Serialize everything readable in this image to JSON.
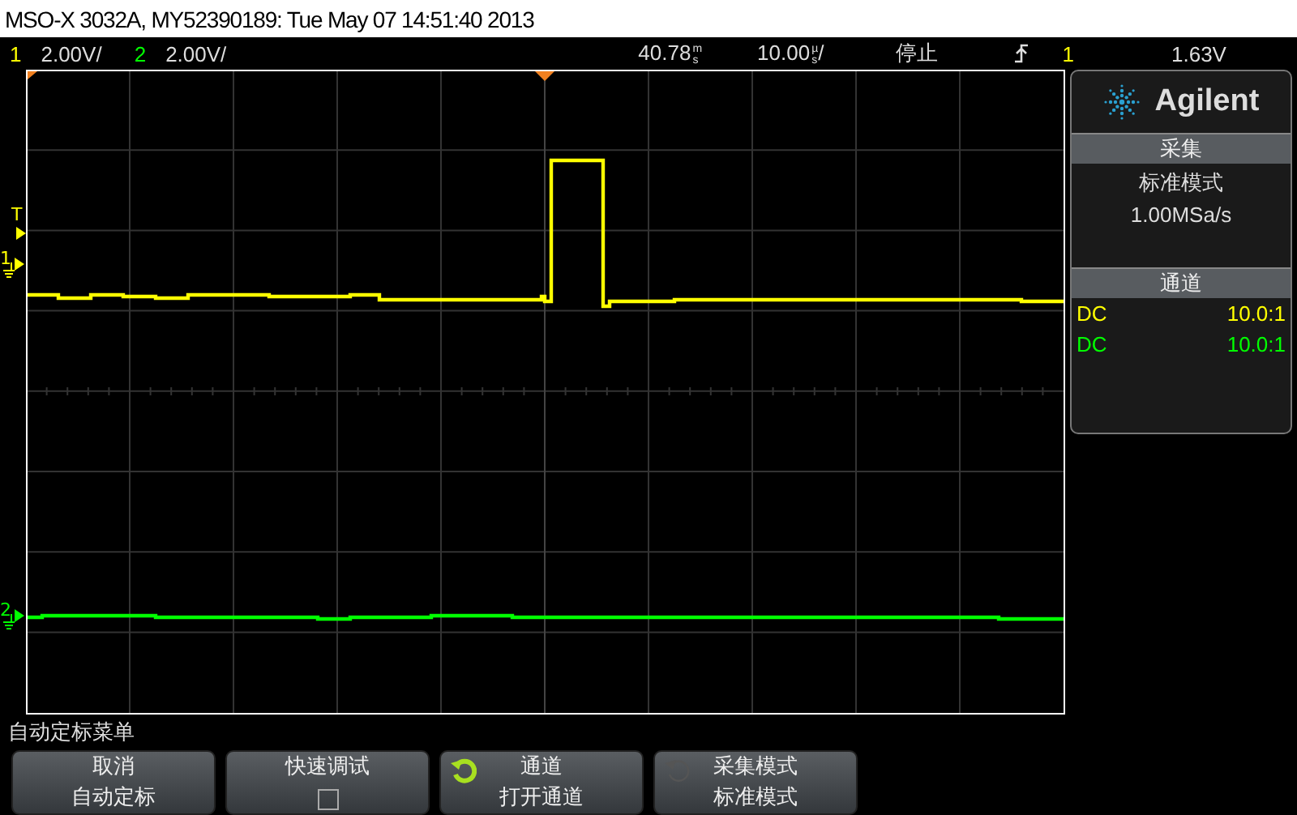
{
  "title_bar": {
    "text": "MSO-X 3032A, MY52390189: Tue May 07 14:51:40 2013"
  },
  "status_bar": {
    "channels": [
      {
        "number": "1",
        "scale": "2.00V/",
        "color": "#ffff00"
      },
      {
        "number": "2",
        "scale": "2.00V/",
        "color": "#00ff00"
      }
    ],
    "delay": {
      "value": "40.78",
      "unit_top": "m",
      "unit_bottom": "s"
    },
    "timebase": {
      "value": "10.00",
      "unit_top": "µ",
      "unit_bottom": "s",
      "suffix": "/"
    },
    "run_state": "停止",
    "trigger": {
      "source": "1",
      "level": "1.63V"
    }
  },
  "markers": {
    "trigger": "T",
    "channels": [
      {
        "label": "1",
        "color": "#ffff00"
      },
      {
        "label": "2",
        "color": "#00ff00"
      }
    ]
  },
  "side_panel": {
    "logo": "Agilent",
    "acquisition": {
      "header": "采集",
      "mode": "标准模式",
      "rate": "1.00MSa/s"
    },
    "channels": {
      "header": "通道",
      "rows": [
        {
          "coupling": "DC",
          "probe": "10.0:1",
          "color": "#ffff00"
        },
        {
          "coupling": "DC",
          "probe": "10.0:1",
          "color": "#00ff00"
        }
      ]
    }
  },
  "menu": {
    "title": "自动定标菜单",
    "buttons": [
      {
        "kind": "text",
        "label": "取消",
        "value": "自动定标"
      },
      {
        "kind": "checkbox",
        "label": "快速调试",
        "checked": false
      },
      {
        "kind": "cycle",
        "label": "通道",
        "value": "打开通道",
        "enabled": true
      },
      {
        "kind": "cycle",
        "label": "采集模式",
        "value": "标准模式",
        "enabled": false
      }
    ]
  }
}
